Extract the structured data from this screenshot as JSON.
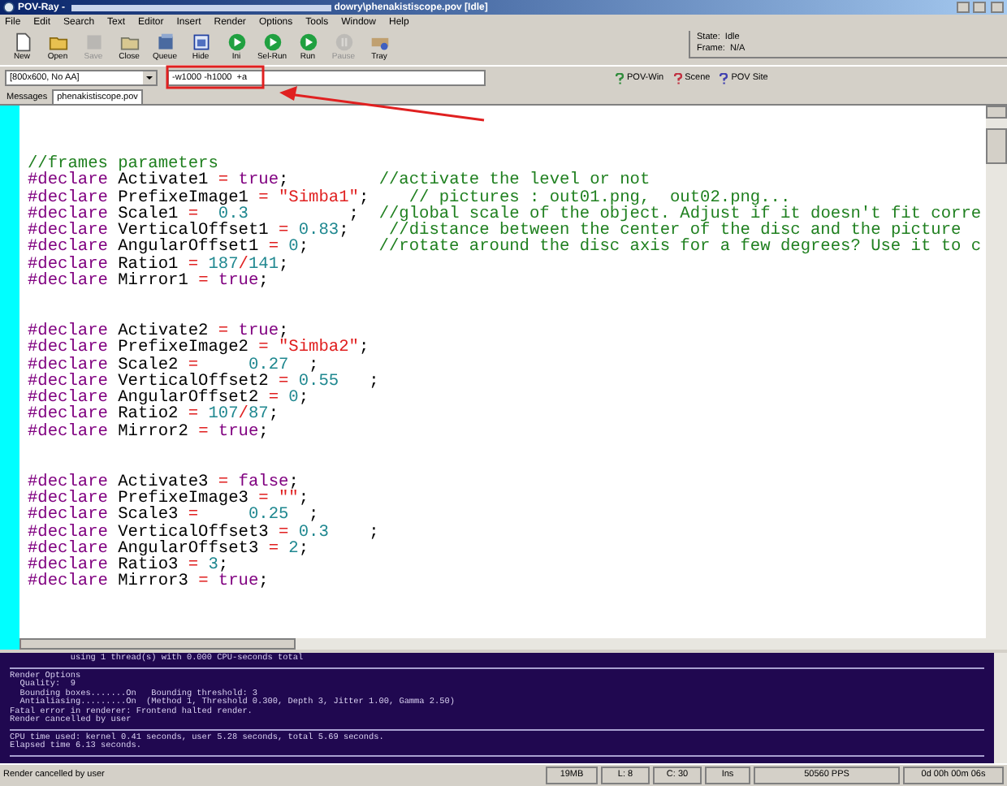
{
  "window": {
    "title_start": "POV-Ray - ",
    "title_end": "dowry\\phenakistiscope.pov [Idle]"
  },
  "menu": [
    "File",
    "Edit",
    "Search",
    "Text",
    "Editor",
    "Insert",
    "Render",
    "Options",
    "Tools",
    "Window",
    "Help"
  ],
  "toolbar": [
    {
      "label": "New",
      "kind": "new",
      "disabled": false
    },
    {
      "label": "Open",
      "kind": "open",
      "disabled": false
    },
    {
      "label": "Save",
      "kind": "save",
      "disabled": true
    },
    {
      "label": "Close",
      "kind": "close",
      "disabled": false
    },
    {
      "label": "Queue",
      "kind": "queue",
      "disabled": false
    },
    {
      "label": "Hide",
      "kind": "hide",
      "disabled": false
    },
    {
      "label": "Ini",
      "kind": "run",
      "disabled": false
    },
    {
      "label": "Sel-Run",
      "kind": "run",
      "disabled": false
    },
    {
      "label": "Run",
      "kind": "run",
      "disabled": false
    },
    {
      "label": "Pause",
      "kind": "pause",
      "disabled": true
    },
    {
      "label": "Tray",
      "kind": "tray",
      "disabled": false
    }
  ],
  "render_status": {
    "state": "State:  Idle",
    "frame": "Frame:  N/A"
  },
  "resolution_dropdown": "[800x600, No AA]",
  "command_line": "-w1000 -h1000  +a",
  "help_links": [
    {
      "label": "POV-Win",
      "color": "#2e8b3a"
    },
    {
      "label": "Scene",
      "color": "#c03040"
    },
    {
      "label": "POV Site",
      "color": "#4040b0"
    }
  ],
  "tabs": [
    {
      "label": "Messages",
      "selected": false
    },
    {
      "label": "phenakistiscope.pov",
      "selected": true
    }
  ],
  "code_lines": [
    {
      "kind": "code",
      "tokens": [
        {
          "kind": "comment",
          "text": "//frames parameters"
        }
      ]
    },
    {
      "kind": "code",
      "tokens": [
        {
          "kind": "kw",
          "text": "#declare"
        },
        {
          "kind": "plain",
          "text": " Activate1 "
        },
        {
          "kind": "op",
          "text": "="
        },
        {
          "kind": "kw",
          "text": " true"
        },
        {
          "kind": "plain",
          "text": ";         "
        },
        {
          "kind": "comment",
          "text": "//activate the level or not"
        }
      ]
    },
    {
      "kind": "code",
      "tokens": [
        {
          "kind": "kw",
          "text": "#declare"
        },
        {
          "kind": "plain",
          "text": " PrefixeImage1 "
        },
        {
          "kind": "op",
          "text": "="
        },
        {
          "kind": "string",
          "text": " \"Simba1\""
        },
        {
          "kind": "plain",
          "text": ";    "
        },
        {
          "kind": "comment",
          "text": "// pictures : out01.png,  out02.png..."
        }
      ]
    },
    {
      "kind": "code",
      "tokens": [
        {
          "kind": "kw",
          "text": "#declare"
        },
        {
          "kind": "plain",
          "text": " Scale1 "
        },
        {
          "kind": "op",
          "text": "="
        },
        {
          "kind": "num",
          "text": "  0.3"
        },
        {
          "kind": "plain",
          "text": "          ;  "
        },
        {
          "kind": "comment",
          "text": "//global scale of the object. Adjust if it doesn't fit corre"
        }
      ]
    },
    {
      "kind": "code",
      "tokens": [
        {
          "kind": "kw",
          "text": "#declare"
        },
        {
          "kind": "plain",
          "text": " VerticalOffset1 "
        },
        {
          "kind": "op",
          "text": "="
        },
        {
          "kind": "num",
          "text": " 0.83"
        },
        {
          "kind": "plain",
          "text": ";    "
        },
        {
          "kind": "comment",
          "text": "//distance between the center of the disc and the picture"
        }
      ]
    },
    {
      "kind": "code",
      "tokens": [
        {
          "kind": "kw",
          "text": "#declare"
        },
        {
          "kind": "plain",
          "text": " AngularOffset1 "
        },
        {
          "kind": "op",
          "text": "="
        },
        {
          "kind": "num",
          "text": " 0"
        },
        {
          "kind": "plain",
          "text": ";       "
        },
        {
          "kind": "comment",
          "text": "//rotate around the disc axis for a few degrees? Use it to c"
        }
      ]
    },
    {
      "kind": "code",
      "tokens": [
        {
          "kind": "kw",
          "text": "#declare"
        },
        {
          "kind": "plain",
          "text": " Ratio1 "
        },
        {
          "kind": "op",
          "text": "="
        },
        {
          "kind": "num",
          "text": " 187"
        },
        {
          "kind": "op",
          "text": "/"
        },
        {
          "kind": "num",
          "text": "141"
        },
        {
          "kind": "plain",
          "text": ";"
        }
      ]
    },
    {
      "kind": "code",
      "tokens": [
        {
          "kind": "kw",
          "text": "#declare"
        },
        {
          "kind": "plain",
          "text": " Mirror1 "
        },
        {
          "kind": "op",
          "text": "="
        },
        {
          "kind": "kw",
          "text": " true"
        },
        {
          "kind": "plain",
          "text": ";"
        }
      ]
    },
    {
      "kind": "blank"
    },
    {
      "kind": "blank"
    },
    {
      "kind": "code",
      "tokens": [
        {
          "kind": "kw",
          "text": "#declare"
        },
        {
          "kind": "plain",
          "text": " Activate2 "
        },
        {
          "kind": "op",
          "text": "="
        },
        {
          "kind": "kw",
          "text": " true"
        },
        {
          "kind": "plain",
          "text": ";"
        }
      ]
    },
    {
      "kind": "code",
      "tokens": [
        {
          "kind": "kw",
          "text": "#declare"
        },
        {
          "kind": "plain",
          "text": " PrefixeImage2 "
        },
        {
          "kind": "op",
          "text": "="
        },
        {
          "kind": "string",
          "text": " \"Simba2\""
        },
        {
          "kind": "plain",
          "text": ";"
        }
      ]
    },
    {
      "kind": "code",
      "tokens": [
        {
          "kind": "kw",
          "text": "#declare"
        },
        {
          "kind": "plain",
          "text": " Scale2 "
        },
        {
          "kind": "op",
          "text": "="
        },
        {
          "kind": "num",
          "text": "     0.27"
        },
        {
          "kind": "plain",
          "text": "  ;"
        }
      ]
    },
    {
      "kind": "code",
      "tokens": [
        {
          "kind": "kw",
          "text": "#declare"
        },
        {
          "kind": "plain",
          "text": " VerticalOffset2 "
        },
        {
          "kind": "op",
          "text": "="
        },
        {
          "kind": "num",
          "text": " 0.55"
        },
        {
          "kind": "plain",
          "text": "   ;"
        }
      ]
    },
    {
      "kind": "code",
      "tokens": [
        {
          "kind": "kw",
          "text": "#declare"
        },
        {
          "kind": "plain",
          "text": " AngularOffset2 "
        },
        {
          "kind": "op",
          "text": "="
        },
        {
          "kind": "num",
          "text": " 0"
        },
        {
          "kind": "plain",
          "text": ";"
        }
      ]
    },
    {
      "kind": "code",
      "tokens": [
        {
          "kind": "kw",
          "text": "#declare"
        },
        {
          "kind": "plain",
          "text": " Ratio2 "
        },
        {
          "kind": "op",
          "text": "="
        },
        {
          "kind": "num",
          "text": " 107"
        },
        {
          "kind": "op",
          "text": "/"
        },
        {
          "kind": "num",
          "text": "87"
        },
        {
          "kind": "plain",
          "text": ";"
        }
      ]
    },
    {
      "kind": "code",
      "tokens": [
        {
          "kind": "kw",
          "text": "#declare"
        },
        {
          "kind": "plain",
          "text": " Mirror2 "
        },
        {
          "kind": "op",
          "text": "="
        },
        {
          "kind": "kw",
          "text": " true"
        },
        {
          "kind": "plain",
          "text": ";"
        }
      ]
    },
    {
      "kind": "blank"
    },
    {
      "kind": "blank"
    },
    {
      "kind": "code",
      "tokens": [
        {
          "kind": "kw",
          "text": "#declare"
        },
        {
          "kind": "plain",
          "text": " Activate3 "
        },
        {
          "kind": "op",
          "text": "="
        },
        {
          "kind": "kw",
          "text": " false"
        },
        {
          "kind": "plain",
          "text": ";"
        }
      ]
    },
    {
      "kind": "code",
      "tokens": [
        {
          "kind": "kw",
          "text": "#declare"
        },
        {
          "kind": "plain",
          "text": " PrefixeImage3 "
        },
        {
          "kind": "op",
          "text": "="
        },
        {
          "kind": "string",
          "text": " \"\""
        },
        {
          "kind": "plain",
          "text": ";"
        }
      ]
    },
    {
      "kind": "code",
      "tokens": [
        {
          "kind": "kw",
          "text": "#declare"
        },
        {
          "kind": "plain",
          "text": " Scale3 "
        },
        {
          "kind": "op",
          "text": "="
        },
        {
          "kind": "num",
          "text": "     0.25"
        },
        {
          "kind": "plain",
          "text": "  ;"
        }
      ]
    },
    {
      "kind": "code",
      "tokens": [
        {
          "kind": "kw",
          "text": "#declare"
        },
        {
          "kind": "plain",
          "text": " VerticalOffset3 "
        },
        {
          "kind": "op",
          "text": "="
        },
        {
          "kind": "num",
          "text": " 0.3"
        },
        {
          "kind": "plain",
          "text": "    ;"
        }
      ]
    },
    {
      "kind": "code",
      "tokens": [
        {
          "kind": "kw",
          "text": "#declare"
        },
        {
          "kind": "plain",
          "text": " AngularOffset3 "
        },
        {
          "kind": "op",
          "text": "="
        },
        {
          "kind": "num",
          "text": " 2"
        },
        {
          "kind": "plain",
          "text": ";"
        }
      ]
    },
    {
      "kind": "code",
      "tokens": [
        {
          "kind": "kw",
          "text": "#declare"
        },
        {
          "kind": "plain",
          "text": " Ratio3 "
        },
        {
          "kind": "op",
          "text": "="
        },
        {
          "kind": "num",
          "text": " 3"
        },
        {
          "kind": "plain",
          "text": ";"
        }
      ]
    },
    {
      "kind": "code",
      "tokens": [
        {
          "kind": "kw",
          "text": "#declare"
        },
        {
          "kind": "plain",
          "text": " Mirror3 "
        },
        {
          "kind": "op",
          "text": "="
        },
        {
          "kind": "kw",
          "text": " true"
        },
        {
          "kind": "plain",
          "text": ";"
        }
      ]
    }
  ],
  "messages": [
    {
      "kind": "text",
      "text": "            using 1 thread(s) with 0.000 CPU-seconds total"
    },
    {
      "kind": "rule"
    },
    {
      "kind": "text",
      "text": "Render Options"
    },
    {
      "kind": "text",
      "text": "  Quality:  9"
    },
    {
      "kind": "text",
      "text": "  Bounding boxes.......On   Bounding threshold: 3"
    },
    {
      "kind": "text",
      "text": "  Antialiasing.........On  (Method 1, Threshold 0.300, Depth 3, Jitter 1.00, Gamma 2.50)"
    },
    {
      "kind": "text",
      "text": "Fatal error in renderer: Frontend halted render."
    },
    {
      "kind": "text",
      "text": "Render cancelled by user"
    },
    {
      "kind": "rule"
    },
    {
      "kind": "text",
      "text": "CPU time used: kernel 0.41 seconds, user 5.28 seconds, total 5.69 seconds."
    },
    {
      "kind": "text",
      "text": "Elapsed time 6.13 seconds."
    },
    {
      "kind": "rule"
    }
  ],
  "status_bar": {
    "message": "Render cancelled by user",
    "panels": [
      "19MB",
      "L: 8",
      "C: 30",
      "Ins",
      "50560 PPS",
      "0d 00h 00m 06s"
    ]
  }
}
